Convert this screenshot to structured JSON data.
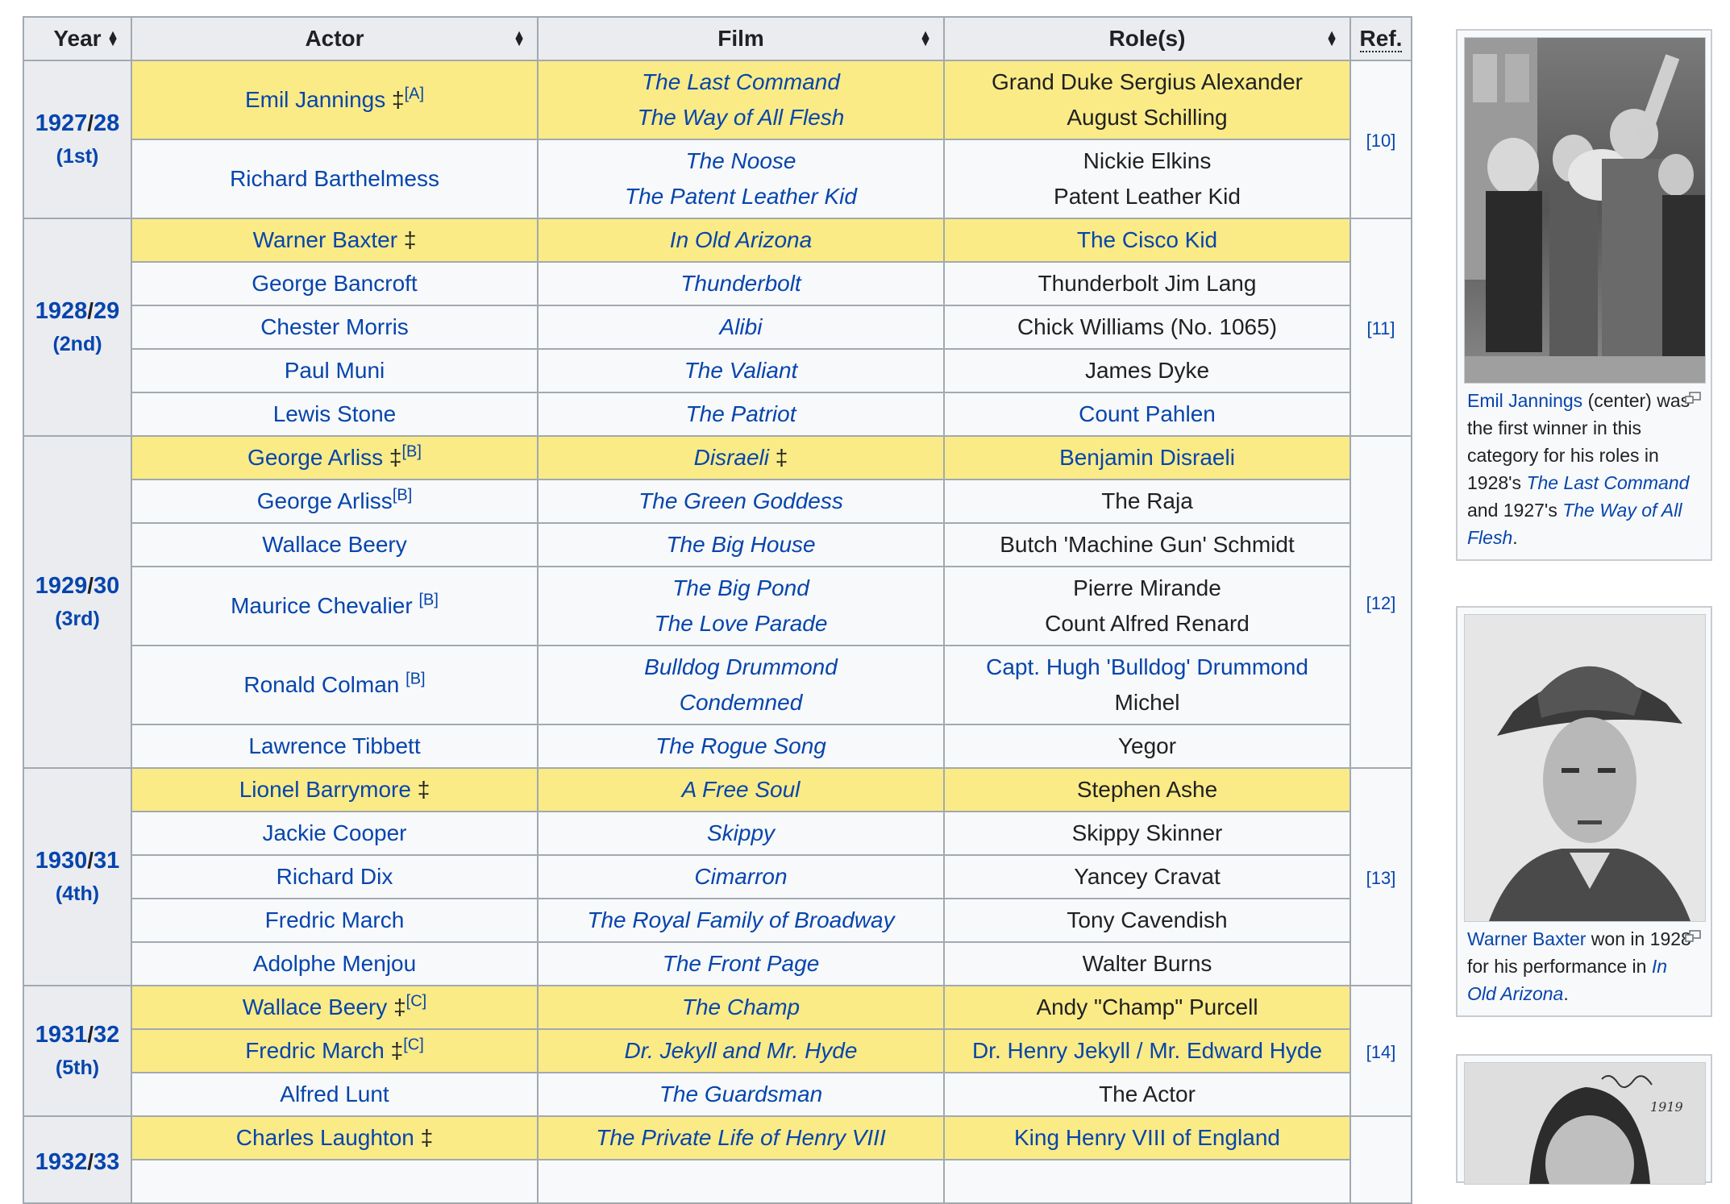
{
  "headers": {
    "year": "Year",
    "actor": "Actor",
    "film": "Film",
    "roles": "Role(s)",
    "ref": "Ref."
  },
  "glyphs": {
    "dagger": "‡"
  },
  "groups": [
    {
      "year_a": "1927",
      "year_b": "28",
      "ceremony": "(1st)",
      "ref": "[10]"
    },
    {
      "year_a": "1928",
      "year_b": "29",
      "ceremony": "(2nd)",
      "ref": "[11]"
    },
    {
      "year_a": "1929",
      "year_b": "30",
      "ceremony": "(3rd)",
      "ref": "[12]"
    },
    {
      "year_a": "1930",
      "year_b": "31",
      "ceremony": "(4th)",
      "ref": "[13]"
    },
    {
      "year_a": "1931",
      "year_b": "32",
      "ceremony": "(5th)",
      "ref": "[14]"
    },
    {
      "year_a": "1932",
      "year_b": "33"
    }
  ],
  "rows": [
    {
      "actor": "Emil Jannings",
      "note": "[A]",
      "film1": "The Last Command",
      "film2": "The Way of All Flesh",
      "role1": "Grand Duke Sergius Alexander",
      "role2": "August Schilling"
    },
    {
      "actor": "Richard Barthelmess",
      "film1": "The Noose",
      "film2": "The Patent Leather Kid",
      "role1": "Nickie Elkins",
      "role2": "Patent Leather Kid"
    },
    {
      "actor": "Warner Baxter",
      "film": "In Old Arizona",
      "role": "The Cisco Kid"
    },
    {
      "actor": "George Bancroft",
      "film": "Thunderbolt",
      "role": "Thunderbolt Jim Lang"
    },
    {
      "actor": "Chester Morris",
      "film": "Alibi",
      "role": "Chick Williams (No. 1065)"
    },
    {
      "actor": "Paul Muni",
      "film": "The Valiant",
      "role": "James Dyke"
    },
    {
      "actor": "Lewis Stone",
      "film": "The Patriot",
      "role": "Count Pahlen"
    },
    {
      "actor": "George Arliss",
      "note": "[B]",
      "film": "Disraeli",
      "role": "Benjamin Disraeli"
    },
    {
      "actor": "George Arliss",
      "note": "[B]",
      "film": "The Green Goddess",
      "role": "The Raja"
    },
    {
      "actor": "Wallace Beery",
      "film": "The Big House",
      "role": "Butch 'Machine Gun' Schmidt"
    },
    {
      "actor": "Maurice Chevalier",
      "note": "[B]",
      "film1": "The Big Pond",
      "film2": "The Love Parade",
      "role1": "Pierre Mirande",
      "role2": "Count Alfred Renard"
    },
    {
      "actor": "Ronald Colman",
      "note": "[B]",
      "film1": "Bulldog Drummond",
      "film2": "Condemned",
      "role1": "Capt. Hugh 'Bulldog' Drummond",
      "role2": "Michel"
    },
    {
      "actor": "Lawrence Tibbett",
      "film": "The Rogue Song",
      "role": "Yegor"
    },
    {
      "actor": "Lionel Barrymore",
      "film": "A Free Soul",
      "role": "Stephen Ashe"
    },
    {
      "actor": "Jackie Cooper",
      "film": "Skippy",
      "role": "Skippy Skinner"
    },
    {
      "actor": "Richard Dix",
      "film": "Cimarron",
      "role": "Yancey Cravat"
    },
    {
      "actor": "Fredric March",
      "film": "The Royal Family of Broadway",
      "role": "Tony Cavendish"
    },
    {
      "actor": "Adolphe Menjou",
      "film": "The Front Page",
      "role": "Walter Burns"
    },
    {
      "actor": "Wallace Beery",
      "note": "[C]",
      "film": "The Champ",
      "role": "Andy \"Champ\" Purcell"
    },
    {
      "actor": "Fredric March",
      "note": "[C]",
      "film": "Dr. Jekyll and Mr. Hyde",
      "role": "Dr. Henry Jekyll / Mr. Edward Hyde"
    },
    {
      "actor": "Alfred Lunt",
      "film": "The Guardsman",
      "role": "The Actor"
    },
    {
      "actor": "Charles Laughton",
      "film": "The Private Life of Henry VIII",
      "role": "King Henry VIII of England"
    }
  ],
  "thumbs": [
    {
      "c1_link": "Emil Jannings",
      "c1_text": " (center) was the first winner in this category for his roles in 1928's ",
      "c1_film1": "The Last Command",
      "c1_mid": " and 1927's ",
      "c1_film2": "The Way of All Flesh",
      "c1_end": "."
    },
    {
      "c2_link": "Warner Baxter",
      "c2_text": " won in 1928 for his performance in ",
      "c2_film": "In Old Arizona",
      "c2_end": "."
    }
  ],
  "thumb3_signature": "1919"
}
